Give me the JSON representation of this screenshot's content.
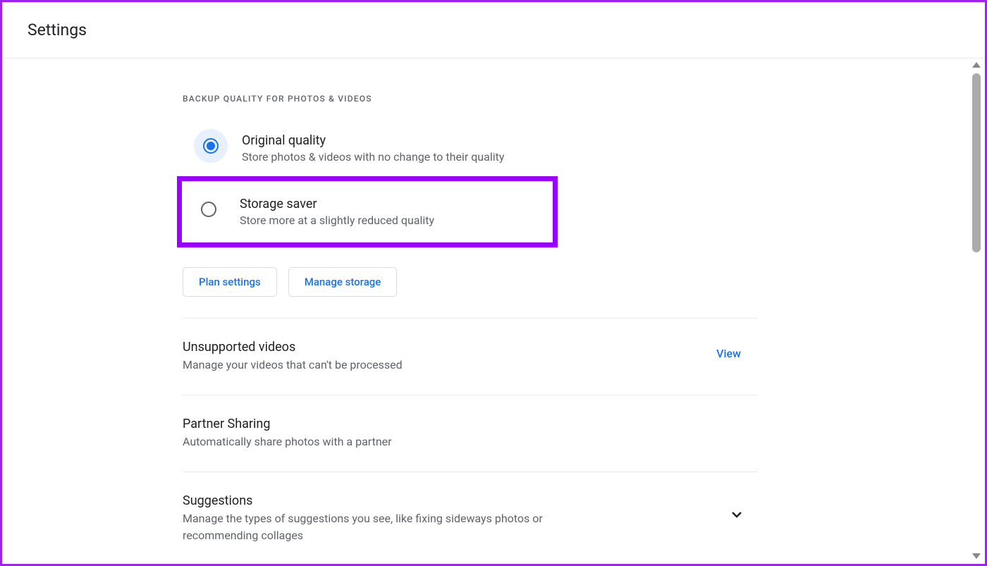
{
  "header": {
    "title": "Settings"
  },
  "backup_quality": {
    "section_label": "BACKUP QUALITY FOR PHOTOS & VIDEOS",
    "options": [
      {
        "title": "Original quality",
        "desc": "Store photos & videos with no change to their quality",
        "selected": true
      },
      {
        "title": "Storage saver",
        "desc": "Store more at a slightly reduced quality",
        "selected": false,
        "highlighted": true
      }
    ],
    "buttons": {
      "plan": "Plan settings",
      "manage": "Manage storage"
    }
  },
  "rows": {
    "unsupported": {
      "title": "Unsupported videos",
      "desc": "Manage your videos that can't be processed",
      "action": "View"
    },
    "partner": {
      "title": "Partner Sharing",
      "desc": "Automatically share photos with a partner"
    },
    "suggestions": {
      "title": "Suggestions",
      "desc": "Manage the types of suggestions you see, like fixing sideways photos or recommending collages"
    }
  }
}
